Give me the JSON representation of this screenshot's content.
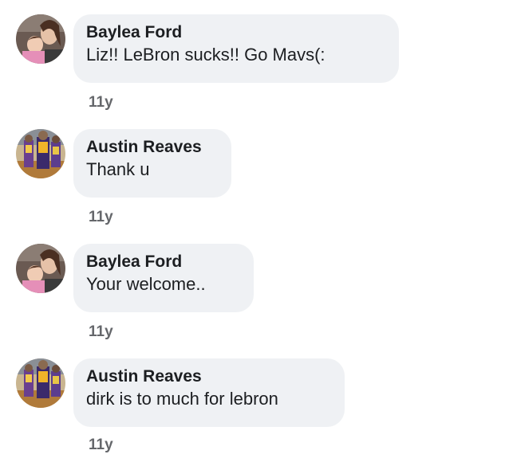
{
  "comments": [
    {
      "author": "Baylea Ford",
      "text": "Liz!! LeBron sucks!! Go Mavs(:",
      "time": "11y",
      "avatar": "baylea-avatar"
    },
    {
      "author": "Austin Reaves",
      "text": "Thank u",
      "time": "11y",
      "avatar": "austin-avatar"
    },
    {
      "author": "Baylea Ford",
      "text": "Your welcome..",
      "time": "11y",
      "avatar": "baylea-avatar"
    },
    {
      "author": "Austin Reaves",
      "text": "dirk is to much for lebron",
      "time": "11y",
      "avatar": "austin-avatar"
    }
  ],
  "colors": {
    "bubble": "#eff1f4",
    "text": "#1c1e21",
    "muted": "#65676b"
  }
}
